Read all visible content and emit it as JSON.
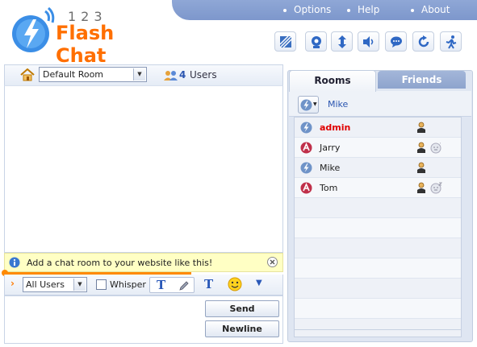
{
  "header": {
    "logo_number": "123",
    "logo_name": "Flash Chat",
    "menu": [
      "Options",
      "Help",
      "About"
    ],
    "toolbar_icons": [
      "skin-icon",
      "webcam-icon",
      "resize-icon",
      "sound-icon",
      "chat-bubble-icon",
      "refresh-icon",
      "run-icon"
    ]
  },
  "room": {
    "selected": "Default Room",
    "user_count": "4",
    "users_label": "Users"
  },
  "info": {
    "message": "Add a chat room to your website like this!"
  },
  "controls": {
    "recipient": "All Users",
    "whisper_label": "Whisper",
    "send_label": "Send",
    "newline_label": "Newline"
  },
  "tabs": {
    "rooms": "Rooms",
    "friends": "Friends"
  },
  "me": {
    "name": "Mike"
  },
  "users": [
    {
      "name": "admin",
      "avatar": "lightning-avatar-icon",
      "highlight": true,
      "status": ""
    },
    {
      "name": "Jarry",
      "avatar": "bot-avatar-icon",
      "highlight": false,
      "status": "away-face-icon"
    },
    {
      "name": "Mike",
      "avatar": "lightning-avatar-icon",
      "highlight": false,
      "status": ""
    },
    {
      "name": "Tom",
      "avatar": "bot-avatar-icon",
      "highlight": false,
      "status": "sleep-face-icon"
    }
  ],
  "colors": {
    "brand_orange": "#ff6f00",
    "accent_blue": "#7d97cc",
    "admin_red": "#e00000",
    "link_blue": "#2a55b0"
  }
}
